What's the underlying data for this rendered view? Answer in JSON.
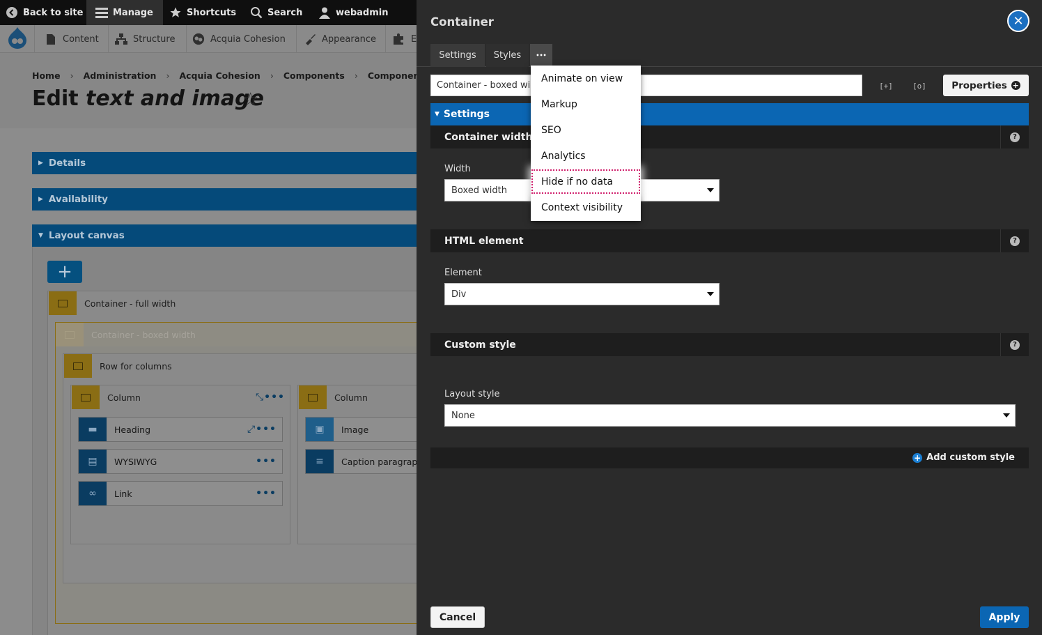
{
  "toolbar": {
    "back_label": "Back to site",
    "manage_label": "Manage",
    "shortcuts_label": "Shortcuts",
    "search_label": "Search",
    "user_label": "webadmin"
  },
  "tray": {
    "items": [
      {
        "label": "Content",
        "icon": "file-icon"
      },
      {
        "label": "Structure",
        "icon": "sitemap-icon"
      },
      {
        "label": "Acquia Cohesion",
        "icon": "cohesion-icon"
      },
      {
        "label": "Appearance",
        "icon": "brush-icon"
      },
      {
        "label": "E",
        "icon": "puzzle-icon"
      }
    ]
  },
  "breadcrumb": [
    "Home",
    "Administration",
    "Acquia Cohesion",
    "Components",
    "Components"
  ],
  "page": {
    "title_prefix": "Edit ",
    "title_em": "text and image"
  },
  "accordions": {
    "details": "Details",
    "availability": "Availability",
    "layout_canvas": "Layout canvas"
  },
  "canvas": {
    "container_full": "Container - full width",
    "container_boxed": "Container - boxed width",
    "row": "Row for columns",
    "column_left": "Column",
    "column_right": "Column",
    "left_elements": [
      "Heading",
      "WYSIWYG",
      "Link"
    ],
    "right_elements": [
      "Image",
      "Caption paragraph"
    ]
  },
  "dialog": {
    "title": "Container",
    "tabs": {
      "settings": "Settings",
      "styles": "Styles",
      "more": "•••"
    },
    "name_value": "Container - boxed width",
    "expand_icon_label": "[+]",
    "inspect_icon_label": "[o]",
    "properties_label": "Properties",
    "settings_band": "Settings",
    "sections": {
      "container_width": {
        "title": "Container width",
        "field_label": "Width",
        "selected": "Boxed width"
      },
      "html_element": {
        "title": "HTML element",
        "field_label": "Element",
        "selected": "Div"
      },
      "custom_style": {
        "title": "Custom style",
        "field_label": "Layout style",
        "selected": "None"
      }
    },
    "add_custom_style": "Add custom style",
    "cancel_label": "Cancel",
    "apply_label": "Apply"
  },
  "more_menu": {
    "items": [
      "Animate on view",
      "Markup",
      "SEO",
      "Analytics",
      "Hide if no data",
      "Context visibility"
    ],
    "highlighted": "Hide if no data"
  },
  "colors": {
    "accent_blue": "#0b66b3",
    "dialog_bg": "#2b2b2b",
    "highlight_outline": "#d1206d",
    "container_gold": "#8a6d14"
  }
}
